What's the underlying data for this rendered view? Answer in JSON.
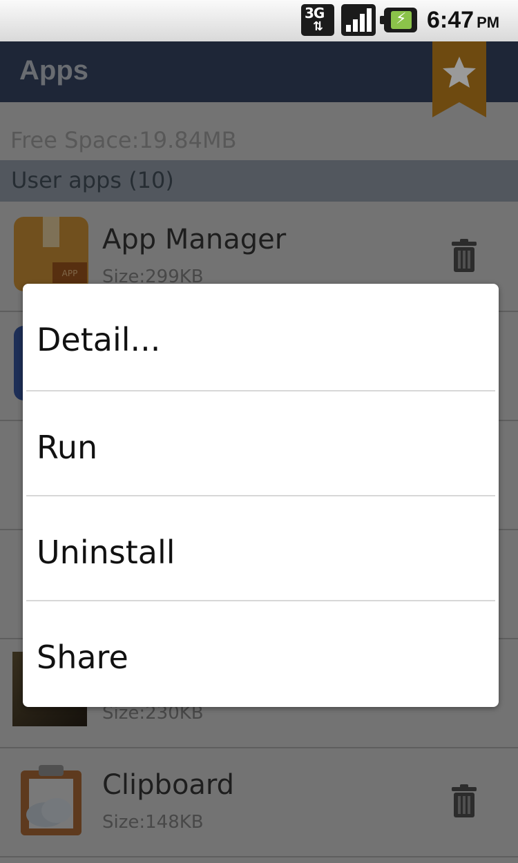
{
  "status_bar": {
    "network": "3G",
    "time": "6:47",
    "ampm": "PM"
  },
  "header": {
    "title": "Apps"
  },
  "free_space": "Free Space:19.84MB",
  "section": {
    "label": "User apps (10)"
  },
  "apps": [
    {
      "name": "App Manager",
      "size": "Size:299KB",
      "icon": "box-icon",
      "badge": "APP"
    },
    {
      "name": "",
      "size": "",
      "icon": "blue-app-icon"
    },
    {
      "name": "",
      "size": "",
      "icon": "star-app-icon"
    },
    {
      "name": "",
      "size": "",
      "icon": "ring-app-icon"
    },
    {
      "name": "",
      "size": "Size:230KB",
      "icon": "photo-app-icon"
    },
    {
      "name": "Clipboard",
      "size": "Size:148KB",
      "icon": "clipboard-icon"
    }
  ],
  "context_menu": {
    "items": [
      "Detail...",
      "Run",
      "Uninstall",
      "Share"
    ]
  },
  "colors": {
    "title_bar": "#3a4a6a",
    "bookmark": "#c88a1e",
    "section_header": "#9da8b5"
  }
}
